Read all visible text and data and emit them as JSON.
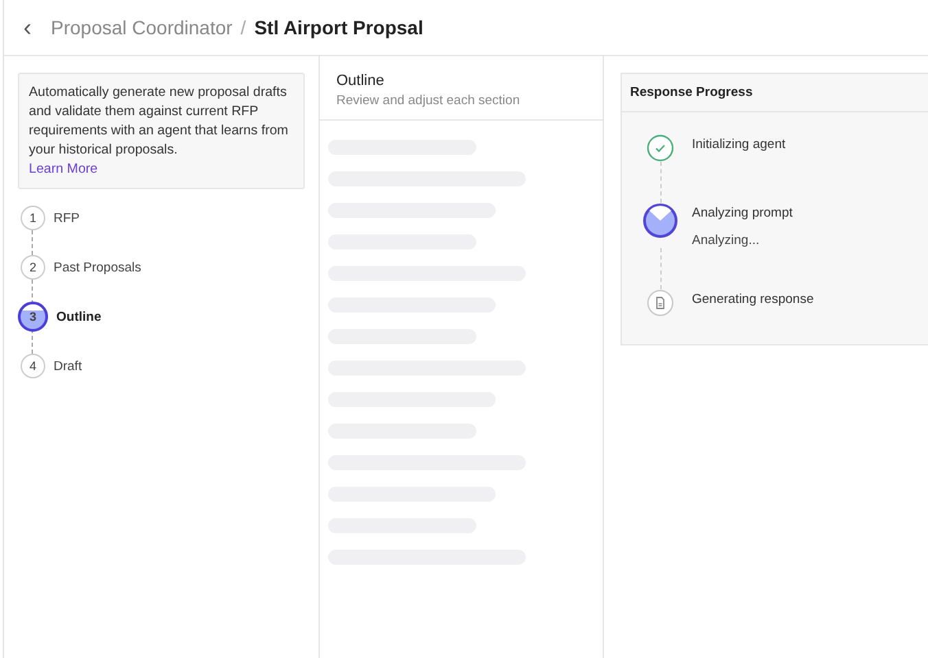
{
  "header": {
    "back": "‹",
    "parent": "Proposal Coordinator",
    "separator": "/",
    "title": "Stl Airport Propsal"
  },
  "info": {
    "text": "Automatically generate new proposal drafts and validate them against current RFP requirements with an agent that learns from your historical proposals.",
    "link": "Learn More"
  },
  "steps": [
    {
      "number": "1",
      "label": "RFP",
      "selected": false
    },
    {
      "number": "2",
      "label": "Past Proposals",
      "selected": false
    },
    {
      "number": "3",
      "label": "Outline",
      "selected": true
    },
    {
      "number": "4",
      "label": "Draft",
      "selected": false
    }
  ],
  "outline": {
    "title": "Outline",
    "subtitle": "Review and adjust each section"
  },
  "progress": {
    "title": "Response Progress",
    "items": [
      {
        "kind": "done",
        "label": "Initializing agent"
      },
      {
        "kind": "active",
        "label": "Analyzing prompt",
        "detail": "Analyzing..."
      },
      {
        "kind": "pending",
        "label": "Generating response"
      }
    ]
  }
}
